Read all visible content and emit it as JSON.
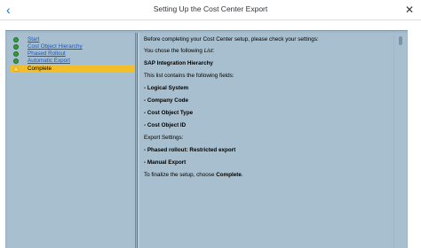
{
  "header": {
    "title": "Setting Up the Cost Center Export",
    "back_icon": "back-arrow-icon",
    "close_icon": "close-icon"
  },
  "steps": [
    {
      "label": "Start",
      "status": "done"
    },
    {
      "label": "Cost Object Hierarchy",
      "status": "done"
    },
    {
      "label": "Phased Rollout",
      "status": "done"
    },
    {
      "label": "Automatic Export",
      "status": "done"
    },
    {
      "label": "Complete",
      "status": "current"
    }
  ],
  "content": {
    "intro": "Before completing your Cost Center setup, please check your settings:",
    "chose_prefix": "You chose the following ",
    "chose_italic": "List",
    "chose_suffix": ":",
    "hierarchy": "SAP Integration Hierarchy",
    "fields_intro": "This list contains the following fields:",
    "fields": [
      "- Logical System",
      "- Company Code",
      "- Cost Object Type",
      "- Cost Object ID"
    ],
    "export_settings": "Export Settings:",
    "export_items": [
      "- Phased rollout: Restricted export",
      "- Manual Export"
    ],
    "finalize_prefix": "To finalize the setup, choose ",
    "finalize_bold": "Complete",
    "finalize_suffix": "."
  },
  "colors": {
    "accent": "#0a6ed1",
    "panel": "#a7bfce",
    "current_step": "#f2be2a",
    "done_dot": "#2f9d3a"
  }
}
